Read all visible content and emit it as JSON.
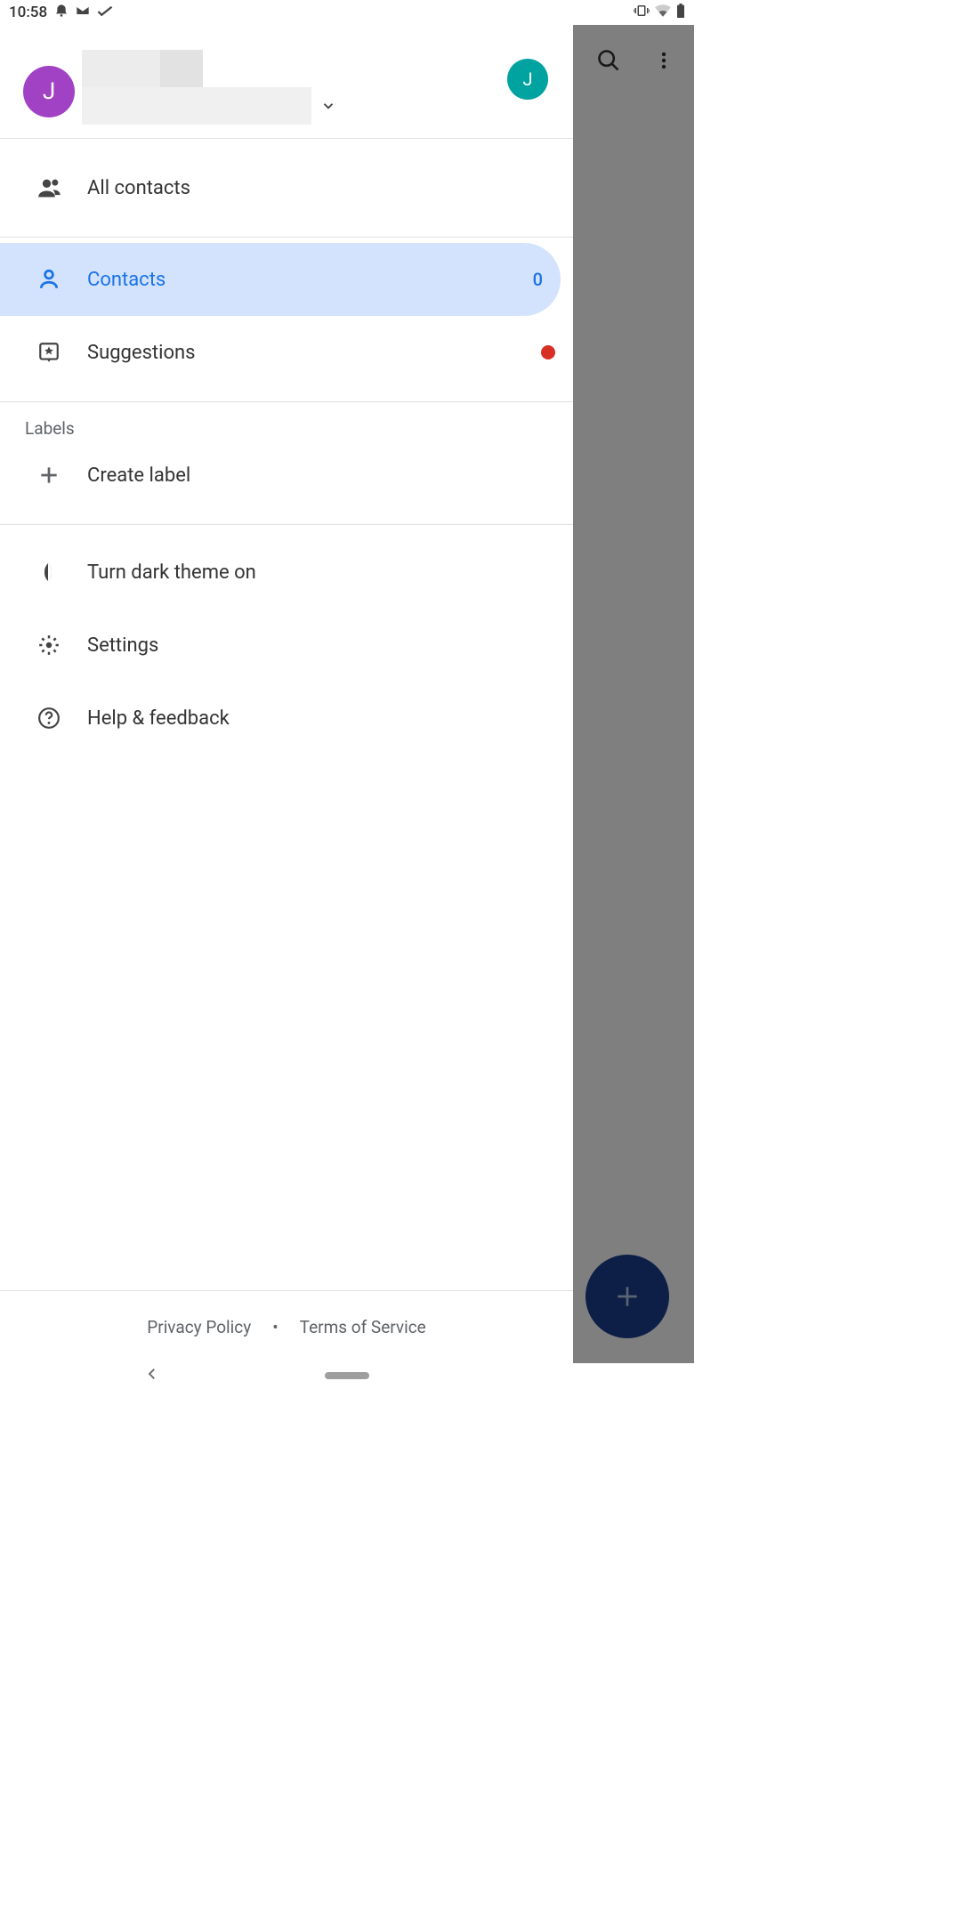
{
  "status": {
    "time": "10:58"
  },
  "drawer": {
    "avatar_large_initial": "J",
    "avatar_small_initial": "J",
    "all_contacts_label": "All contacts",
    "contacts_label": "Contacts",
    "contacts_count": "0",
    "suggestions_label": "Suggestions",
    "labels_header": "Labels",
    "create_label": "Create label",
    "dark_theme_label": "Turn dark theme on",
    "settings_label": "Settings",
    "help_label": "Help & feedback",
    "privacy_label": "Privacy Policy",
    "terms_label": "Terms of Service"
  }
}
